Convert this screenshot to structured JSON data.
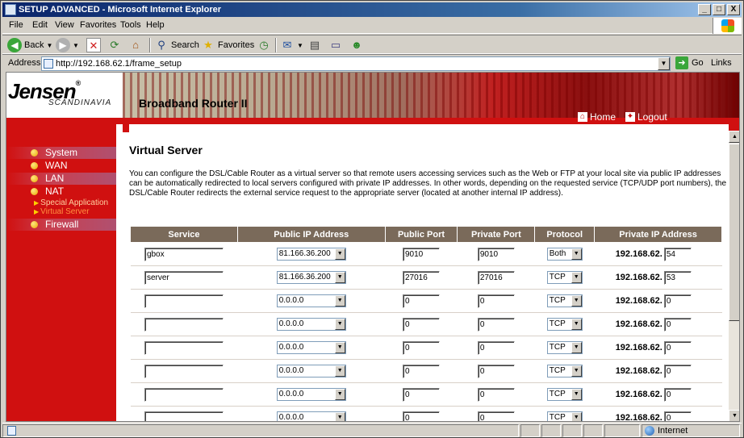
{
  "window": {
    "title": "SETUP ADVANCED - Microsoft Internet Explorer",
    "min": "_",
    "max": "□",
    "close": "X"
  },
  "menu": [
    "File",
    "Edit",
    "View",
    "Favorites",
    "Tools",
    "Help"
  ],
  "toolbar": {
    "back": "Back",
    "search": "Search",
    "favorites": "Favorites"
  },
  "address": {
    "label": "Address",
    "url": "http://192.168.62.1/frame_setup",
    "go": "Go",
    "links": "Links"
  },
  "banner": {
    "brand": "Jensen",
    "brand_sub": "SCANDINAVIA",
    "product": "Broadband Router II",
    "home": "Home",
    "logout": "Logout"
  },
  "sidebar": {
    "items": [
      "System",
      "WAN",
      "LAN",
      "NAT",
      "Firewall"
    ],
    "nat_sub": [
      "Special Application",
      "Virtual Server"
    ]
  },
  "page": {
    "title": "Virtual Server",
    "description": "You can configure the DSL/Cable Router as a virtual server so that remote users accessing services such as the Web or FTP at your local site via public IP addresses can be automatically redirected to local servers configured with private IP addresses. In other words, depending on the requested service (TCP/UDP port numbers), the DSL/Cable Router redirects the external service request to the appropriate server (located at another internal IP address)."
  },
  "table": {
    "headers": [
      "Service",
      "Public IP Address",
      "Public Port",
      "Private Port",
      "Protocol",
      "Private IP Address"
    ],
    "ip_prefix": "192.168.62.",
    "rows": [
      {
        "service": "gbox",
        "public_ip": "81.166.36.200",
        "public_port": "9010",
        "private_port": "9010",
        "protocol": "Both",
        "private_ip_last": "54"
      },
      {
        "service": "server",
        "public_ip": "81.166.36.200",
        "public_port": "27016",
        "private_port": "27016",
        "protocol": "TCP",
        "private_ip_last": "53"
      },
      {
        "service": "",
        "public_ip": "0.0.0.0",
        "public_port": "0",
        "private_port": "0",
        "protocol": "TCP",
        "private_ip_last": "0"
      },
      {
        "service": "",
        "public_ip": "0.0.0.0",
        "public_port": "0",
        "private_port": "0",
        "protocol": "TCP",
        "private_ip_last": "0"
      },
      {
        "service": "",
        "public_ip": "0.0.0.0",
        "public_port": "0",
        "private_port": "0",
        "protocol": "TCP",
        "private_ip_last": "0"
      },
      {
        "service": "",
        "public_ip": "0.0.0.0",
        "public_port": "0",
        "private_port": "0",
        "protocol": "TCP",
        "private_ip_last": "0"
      },
      {
        "service": "",
        "public_ip": "0.0.0.0",
        "public_port": "0",
        "private_port": "0",
        "protocol": "TCP",
        "private_ip_last": "0"
      },
      {
        "service": "",
        "public_ip": "0.0.0.0",
        "public_port": "0",
        "private_port": "0",
        "protocol": "TCP",
        "private_ip_last": "0"
      }
    ]
  },
  "status": {
    "zone": "Internet"
  },
  "colors": {
    "brand_red": "#d01010",
    "table_header": "#7a6a5a"
  }
}
